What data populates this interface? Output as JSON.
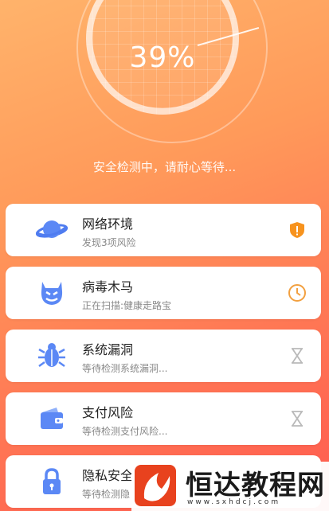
{
  "scan": {
    "percent_label": "39%",
    "progress": 0.39,
    "status": "安全检测中，请耐心等待..."
  },
  "items": [
    {
      "title": "网络环境",
      "subtitle": "发现3项风险",
      "icon": "planet-icon",
      "status": "warning-shield-icon"
    },
    {
      "title": "病毒木马",
      "subtitle": "正在扫描:健康走路宝",
      "icon": "devil-icon",
      "status": "clock-icon"
    },
    {
      "title": "系统漏洞",
      "subtitle": "等待检测系统漏洞...",
      "icon": "bug-icon",
      "status": "hourglass-icon"
    },
    {
      "title": "支付风险",
      "subtitle": "等待检测支付风险...",
      "icon": "wallet-icon",
      "status": "hourglass-icon"
    },
    {
      "title": "隐私安全",
      "subtitle": "等待检测隐",
      "icon": "lock-icon",
      "status": "hourglass-icon"
    }
  ],
  "watermark": {
    "brand": "恒达教程网",
    "url": "www.sxhdcj.com"
  },
  "colors": {
    "accent_blue": "#4f7cf0",
    "warning_orange": "#f7931e",
    "clock_orange": "#f2a040",
    "muted_gray": "#b9b9b9"
  }
}
